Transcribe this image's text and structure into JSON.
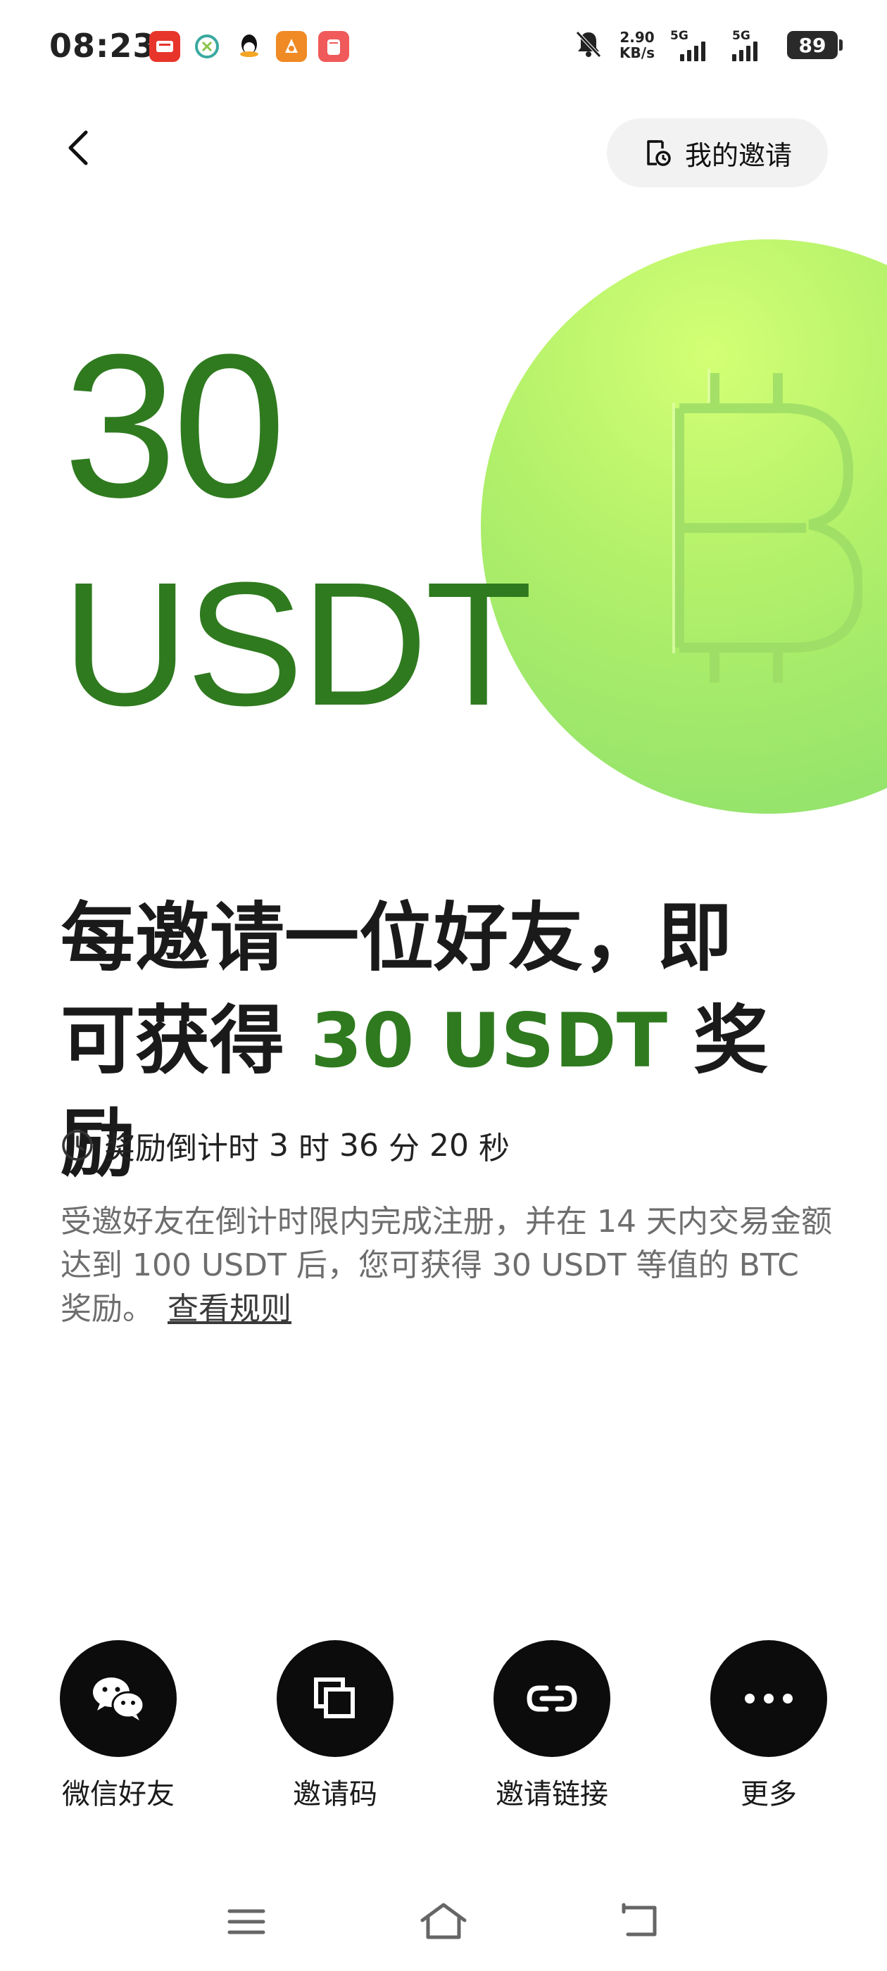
{
  "status_bar": {
    "time": "08:23",
    "net_speed_value": "2.90",
    "net_speed_unit": "KB/s",
    "signal1_tag": "5G",
    "signal2_tag": "5G",
    "battery": "89"
  },
  "header": {
    "my_invite_label": "我的邀请"
  },
  "hero": {
    "amount": "30",
    "unit": "USDT"
  },
  "headline": {
    "line1": "每邀请一位好友，即",
    "prefix2": "可获得",
    "highlight": "30 USDT",
    "suffix2": "奖励"
  },
  "countdown": {
    "label": "奖励倒计时",
    "hours": "3",
    "hours_unit": "时",
    "minutes": "36",
    "minutes_unit": "分",
    "seconds": "20",
    "seconds_unit": "秒"
  },
  "description": {
    "text": "受邀好友在倒计时限内完成注册，并在 14 天内交易金额达到 100 USDT 后，您可获得 30 USDT 等值的 BTC 奖励。",
    "rules_link": "查看规则"
  },
  "share": [
    {
      "label": "微信好友",
      "icon": "wechat-icon"
    },
    {
      "label": "邀请码",
      "icon": "copy-icon"
    },
    {
      "label": "邀请链接",
      "icon": "link-icon"
    },
    {
      "label": "更多",
      "icon": "more-icon"
    }
  ],
  "colors": {
    "accent_green": "#2f7a1f",
    "coin_light": "#d3ff74",
    "coin_dark": "#88de6c",
    "share_button_bg": "#0c0c0c"
  }
}
